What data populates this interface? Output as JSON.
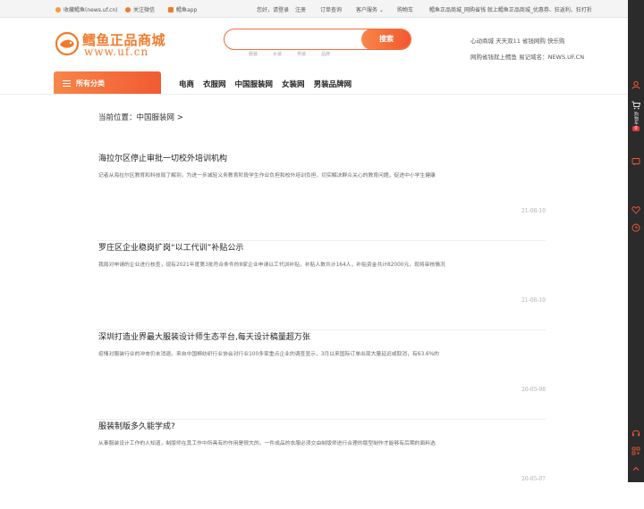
{
  "topbar": {
    "left": [
      {
        "label": "收藏鳕鱼(news.uf.cn)",
        "icon": "star-icon",
        "color": "#f29d38"
      },
      {
        "label": "关注微信",
        "icon": "wechat-icon",
        "color": "#f07a2a"
      },
      {
        "label": "鳕鱼app",
        "icon": "app-icon",
        "color": "#f07a2a"
      }
    ],
    "greeting": "您好，请登录",
    "register": "注册",
    "orders": "订单查询",
    "service": "客户服务",
    "cart": "购物车",
    "promo": "鳕鱼正品商城_网购省钱 就上鳕鱼正品商城_优惠券、狂返利、狂打折"
  },
  "logo": {
    "cn": "鳕鱼正品商城",
    "en": "www.uf.cn"
  },
  "search": {
    "placeholder": "",
    "button": "搜索",
    "hot": [
      "服装",
      "女装",
      "男装",
      "品牌"
    ]
  },
  "slogan": {
    "line1": "心动商城 天天双11 省钱网购 快乐购",
    "line2": "网购省钱就上鳕鱼 易记域名：NEWS.UF.CN"
  },
  "category": {
    "all_label": "所有分类",
    "nav": [
      "电商",
      "衣服网",
      "中国服装网",
      "女装网",
      "男装品牌网"
    ]
  },
  "breadcrumb": "当前位置：中国服装网 >",
  "articles": [
    {
      "title": "海拉尔区停止审批一切校外培训机构",
      "summary": "记者从海拉尔区教育和科技局了解到，为进一步减轻义务教育阶段学生作业负担和校外培训负担，切实解决群众关心的教育问题，促进中小学生健康",
      "date": "21-08-10"
    },
    {
      "title": "罗庄区企业稳岗扩岗“以工代训”补贴公示",
      "summary": "我局对申请的企业进行核查，现有2021年度第3批符合条件的8家企业申请以工代训补贴，补贴人数共计164人，补贴资金共计82000元，现将审核情况",
      "date": "21-08-10"
    },
    {
      "title": "深圳打造业界最大服装设计师生态平台,每天设计稿量超万张",
      "summary": "疫情对服装行业的冲击仍未消退。来自中国棉纺织行业协会对行业100多家重点企业的调查显示，3月以来国际订单出现大量延迟或取消，有63.6%的",
      "date": "20-05-08"
    },
    {
      "title": "服装制版多久能学成?",
      "summary": "从事服装设计工作的人知道，制版师在其工作中所具有的作用是很大的。一件成品的衣服必须交由制版师进行合理的版型制作才能够有后期的面料选",
      "date": "20-05-07"
    }
  ],
  "sidebar": {
    "cart_label": "购物车",
    "cart_count": "0"
  },
  "colors": {
    "accent": "#f25a32",
    "accent_light": "#f7874a",
    "sidebar": "#2b2b2b",
    "badge": "#e4393c"
  }
}
